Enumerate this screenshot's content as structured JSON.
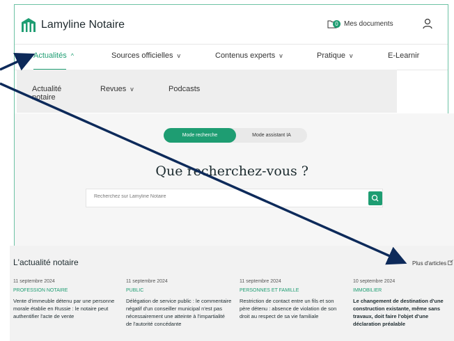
{
  "header": {
    "brand": "Lamyline Notaire",
    "documents_label": "Mes documents",
    "documents_count": "0"
  },
  "nav": {
    "items": [
      {
        "label": "Actualités",
        "active": true,
        "chevron": "^"
      },
      {
        "label": "Sources officielles",
        "active": false,
        "chevron": "v"
      },
      {
        "label": "Contenus experts",
        "active": false,
        "chevron": "v"
      },
      {
        "label": "Pratique",
        "active": false,
        "chevron": "v"
      },
      {
        "label": "E-Learnir",
        "active": false,
        "chevron": ""
      }
    ]
  },
  "subnav": {
    "items": [
      {
        "label": "Actualité notaire"
      },
      {
        "label": "Revues"
      },
      {
        "label": "Podcasts"
      }
    ]
  },
  "search": {
    "mode_active": "Mode recherche",
    "mode_inactive": "Mode assistant IA",
    "question": "Que recherchez-vous ?",
    "placeholder": "Recherchez sur Lamyline Notaire"
  },
  "news": {
    "title": "L'actualité notaire",
    "more_label": "Plus d'articles",
    "cards": [
      {
        "date": "11 septembre 2024",
        "category": "PROFESSION NOTAIRE",
        "title": "Vente d'immeuble détenu par une personne morale établie en Russie : le notaire peut authentifier l'acte de vente"
      },
      {
        "date": "11 septembre 2024",
        "category": "PUBLIC",
        "title": "Délégation de service public : le commentaire négatif d'un conseiller municipal n'est pas nécessairement une atteinte à l'impartialité de l'autorité concédante"
      },
      {
        "date": "11 septembre 2024",
        "category": "PERSONNES ET FAMILLE",
        "title": "Restriction de contact entre un fils et son père détenu : absence de violation de son droit au respect de sa vie familiale"
      },
      {
        "date": "10 septembre 2024",
        "category": "IMMOBILIER",
        "title": "Le changement de destination d'une construction existante, même sans travaux, doit faire l'objet d'une déclaration préalable"
      }
    ]
  },
  "colors": {
    "accent": "#1e9d72",
    "annotation_arrow": "#0d2a5a"
  },
  "icons": [
    "logo-icon",
    "folder-icon",
    "user-icon",
    "search-icon",
    "chevron-up-icon",
    "chevron-down-icon",
    "external-link-icon"
  ]
}
